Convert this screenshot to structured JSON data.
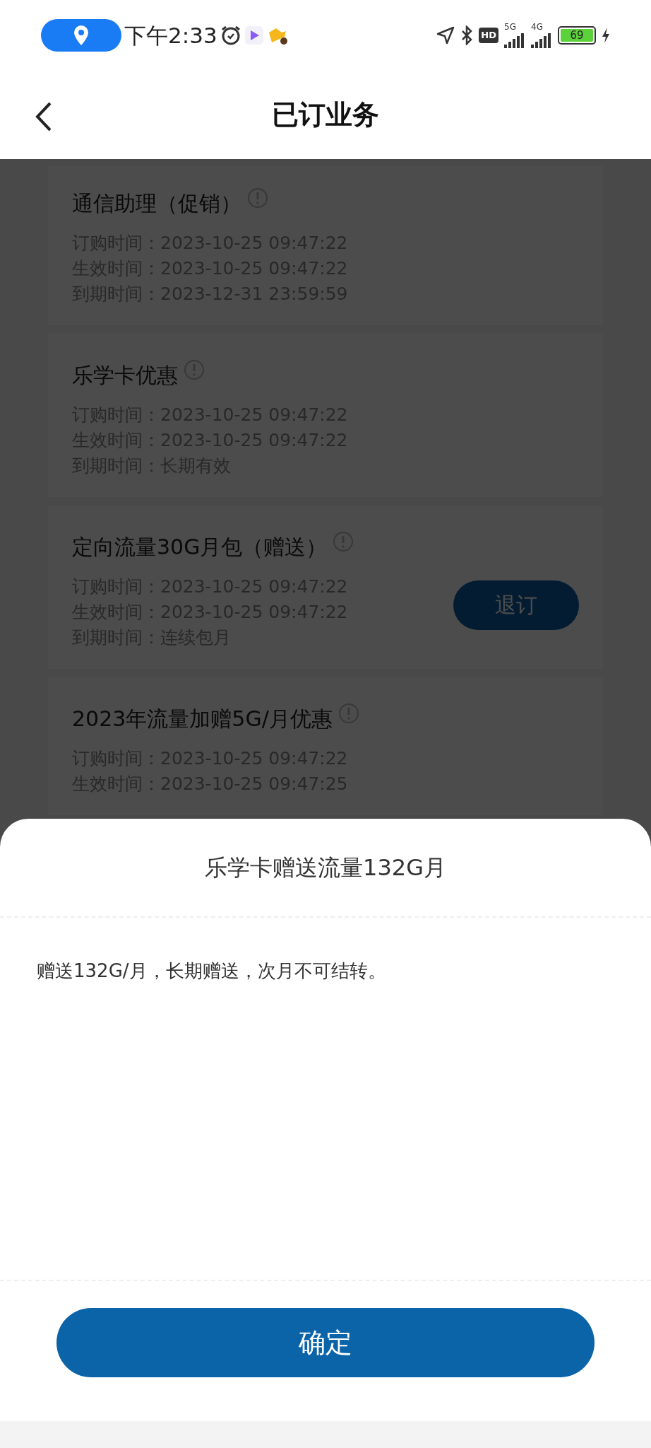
{
  "status_bar": {
    "time": "下午2:33",
    "hd": "HD",
    "network_1": "5G",
    "network_2": "4G",
    "battery": "69"
  },
  "header": {
    "title": "已订业务"
  },
  "services": [
    {
      "name": "通信助理（促销）",
      "rows": [
        {
          "label": "订购时间：",
          "value": "2023-10-25 09:47:22"
        },
        {
          "label": "生效时间：",
          "value": "2023-10-25 09:47:22"
        },
        {
          "label": "到期时间：",
          "value": "2023-12-31 23:59:59"
        }
      ]
    },
    {
      "name": "乐学卡优惠",
      "rows": [
        {
          "label": "订购时间：",
          "value": "2023-10-25 09:47:22"
        },
        {
          "label": "生效时间：",
          "value": "2023-10-25 09:47:22"
        },
        {
          "label": "到期时间：",
          "value": "长期有效"
        }
      ]
    },
    {
      "name": "定向流量30G月包（赠送）",
      "action": "退订",
      "rows": [
        {
          "label": "订购时间：",
          "value": "2023-10-25 09:47:22"
        },
        {
          "label": "生效时间：",
          "value": "2023-10-25 09:47:22"
        },
        {
          "label": "到期时间：",
          "value": "连续包月"
        }
      ]
    },
    {
      "name": "2023年流量加赠5G/月优惠",
      "rows": [
        {
          "label": "订购时间：",
          "value": "2023-10-25 09:47:22"
        },
        {
          "label": "生效时间：",
          "value": "2023-10-25 09:47:25"
        }
      ]
    }
  ],
  "sheet": {
    "title": "乐学卡赠送流量132G月",
    "body": "赠送132G/月，长期赠送，次月不可结转。",
    "confirm": "确定"
  }
}
